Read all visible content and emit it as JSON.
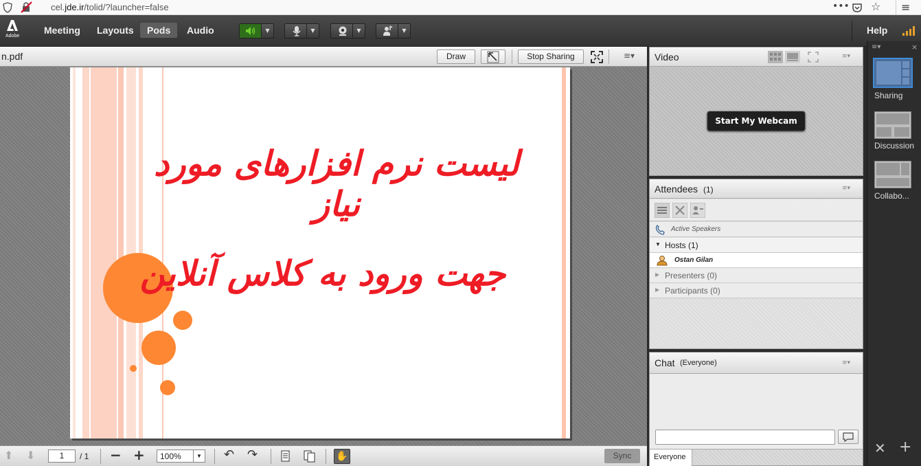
{
  "browser": {
    "url_prefix": "cel.",
    "url_domain": "jde.ir",
    "url_path": "/tolid/?launcher=false"
  },
  "toolbar": {
    "logo": "Adobe",
    "menus": [
      "Meeting",
      "Layouts",
      "Pods",
      "Audio"
    ],
    "active_menu": "Pods",
    "help": "Help"
  },
  "share_pod": {
    "filename": "n.pdf",
    "draw_label": "Draw",
    "stop_sharing_label": "Stop Sharing",
    "slide_line1": "لیست نرم افزارهای مورد نیاز",
    "slide_line2": "جهت ورود به کلاس آنلاین",
    "page_current": "1",
    "page_total": "/ 1",
    "zoom": "100%",
    "sync_label": "Sync"
  },
  "video_pod": {
    "title": "Video",
    "start_webcam_label": "Start My Webcam"
  },
  "attendees_pod": {
    "title": "Attendees",
    "count": "(1)",
    "active_speakers": "Active Speakers",
    "hosts_label": "Hosts (1)",
    "host_name": "Ostan Gilan",
    "presenters_label": "Presenters (0)",
    "participants_label": "Participants (0)"
  },
  "chat_pod": {
    "title": "Chat",
    "scope": "(Everyone)",
    "input_value": "",
    "tab_label": "Everyone"
  },
  "layouts": [
    "Sharing",
    "Discussion",
    "Collabo..."
  ],
  "colors": {
    "slide_text": "#ee1c25",
    "bubble": "#fd8733",
    "speaker_active": "#6ed12b"
  }
}
